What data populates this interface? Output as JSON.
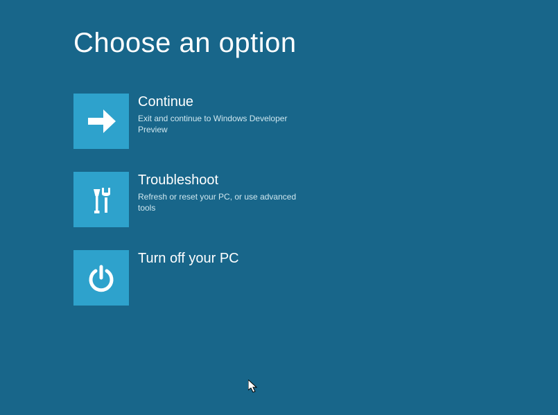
{
  "title": "Choose an option",
  "options": [
    {
      "id": "continue",
      "title": "Continue",
      "desc": "Exit and continue to Windows Developer Preview"
    },
    {
      "id": "troubleshoot",
      "title": "Troubleshoot",
      "desc": "Refresh or reset your PC, or use advanced tools"
    },
    {
      "id": "turnoff",
      "title": "Turn off your PC",
      "desc": ""
    }
  ],
  "colors": {
    "background": "#18668a",
    "tile": "#2ea2cc",
    "text": "#ffffff"
  }
}
